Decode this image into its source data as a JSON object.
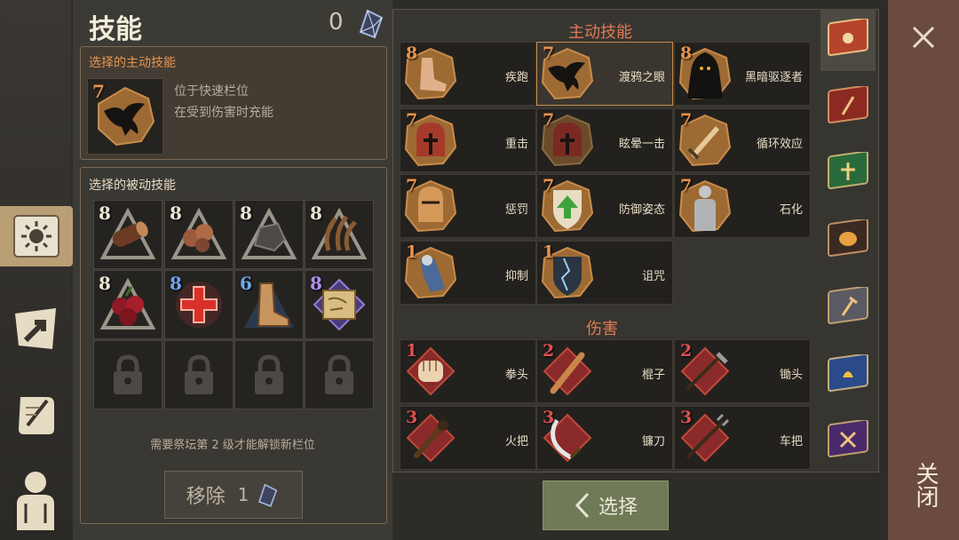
{
  "header": {
    "title": "技能",
    "points": "0"
  },
  "active_panel": {
    "label": "选择的主动技能",
    "level": "7",
    "desc_line1": "位于快速栏位",
    "desc_line2": "在受到伤害时充能"
  },
  "passive_panel": {
    "label": "选择的被动技能",
    "slots": [
      {
        "level": "8",
        "icon": "log-icon"
      },
      {
        "level": "8",
        "icon": "copper-ore-icon"
      },
      {
        "level": "8",
        "icon": "stone-icon"
      },
      {
        "level": "8",
        "icon": "fiber-icon"
      },
      {
        "level": "8",
        "icon": "berries-icon"
      },
      {
        "level": "8",
        "icon": "healing-cross-icon"
      },
      {
        "level": "6",
        "icon": "boot-icon"
      },
      {
        "level": "8",
        "icon": "map-scroll-icon"
      }
    ],
    "unlock_note": "需要祭坛第 2 级才能解锁新栏位"
  },
  "remove_button": {
    "label": "移除",
    "cost": "1"
  },
  "active_skills": {
    "title": "主动技能",
    "items": [
      {
        "level": "8",
        "name": "疾跑",
        "icon": "sprint-boot-icon"
      },
      {
        "level": "7",
        "name": "渡鸦之眼",
        "icon": "raven-icon"
      },
      {
        "level": "8",
        "name": "黑暗驱逐者",
        "icon": "hooded-figure-icon"
      },
      {
        "level": "7",
        "name": "重击",
        "icon": "helmet-cross-icon"
      },
      {
        "level": "7",
        "name": "眩晕一击",
        "icon": "helmet-stun-icon"
      },
      {
        "level": "7",
        "name": "循环效应",
        "icon": "sword-icon"
      },
      {
        "level": "7",
        "name": "惩罚",
        "icon": "knight-helm-icon"
      },
      {
        "level": "7",
        "name": "防御姿态",
        "icon": "shield-arrow-icon"
      },
      {
        "level": "7",
        "name": "石化",
        "icon": "statue-icon"
      },
      {
        "level": "1",
        "name": "抑制",
        "icon": "gauntlet-icon"
      },
      {
        "level": "1",
        "name": "诅咒",
        "icon": "cracked-shield-icon"
      }
    ]
  },
  "damage_skills": {
    "title": "伤害",
    "items": [
      {
        "level": "1",
        "name": "拳头",
        "icon": "fist-icon"
      },
      {
        "level": "2",
        "name": "棍子",
        "icon": "club-icon"
      },
      {
        "level": "2",
        "name": "锄头",
        "icon": "hoe-icon"
      },
      {
        "level": "3",
        "name": "火把",
        "icon": "torch-icon"
      },
      {
        "level": "3",
        "name": "镰刀",
        "icon": "scythe-icon"
      },
      {
        "level": "3",
        "name": "车把",
        "icon": "pitchfork-icon"
      }
    ]
  },
  "select_button": {
    "label": "选择"
  },
  "close": {
    "label": "关闭"
  },
  "colors": {
    "accent": "#e07a55",
    "selected_border": "#c98c4c",
    "button_green": "#6f7a57",
    "close_bg": "#6b4a3f"
  }
}
